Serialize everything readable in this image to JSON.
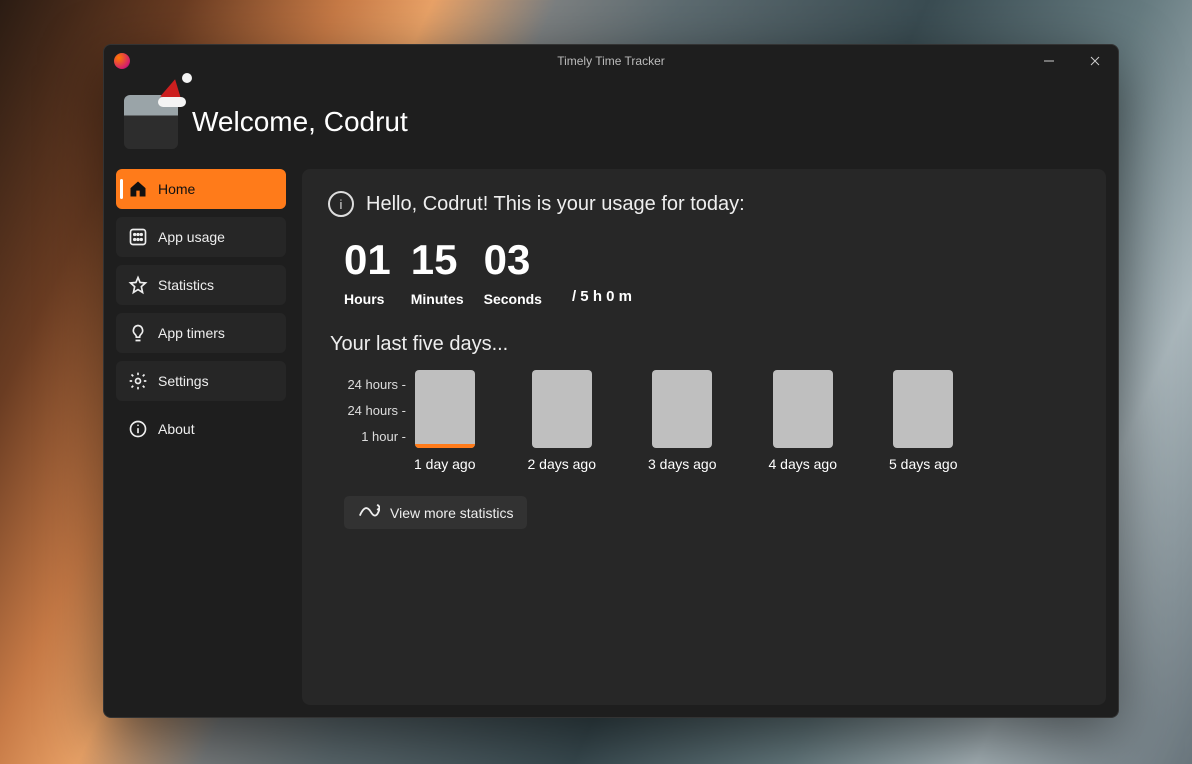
{
  "window": {
    "title": "Timely Time Tracker"
  },
  "header": {
    "welcome": "Welcome, Codrut"
  },
  "sidebar": {
    "items": [
      {
        "label": "Home",
        "icon": "home-icon",
        "active": true
      },
      {
        "label": "App usage",
        "icon": "grid-icon",
        "active": false
      },
      {
        "label": "Statistics",
        "icon": "star-icon",
        "active": false
      },
      {
        "label": "App timers",
        "icon": "bulb-icon",
        "active": false
      },
      {
        "label": "Settings",
        "icon": "gear-icon",
        "active": false
      },
      {
        "label": "About",
        "icon": "info-icon",
        "active": false
      }
    ]
  },
  "main": {
    "greeting": "Hello, Codrut! This is your usage for today:",
    "usage": {
      "hours": {
        "value": "01",
        "label": "Hours"
      },
      "minutes": {
        "value": "15",
        "label": "Minutes"
      },
      "seconds": {
        "value": "03",
        "label": "Seconds"
      },
      "limit": "/ 5 h 0 m"
    },
    "history_title": "Your last five days...",
    "view_more_label": "View more statistics"
  },
  "chart_data": {
    "type": "bar",
    "title": "Your last five days...",
    "categories": [
      "1 day ago",
      "2 days ago",
      "3 days ago",
      "4 days ago",
      "5 days ago"
    ],
    "values_hours": [
      1.25,
      0.1,
      0,
      0,
      0
    ],
    "y_ticks": [
      "24 hours -",
      "24 hours -",
      "1 hour -"
    ],
    "ylabel": "hours",
    "ylim": [
      0,
      24
    ],
    "accent": "#ff7b1a"
  }
}
